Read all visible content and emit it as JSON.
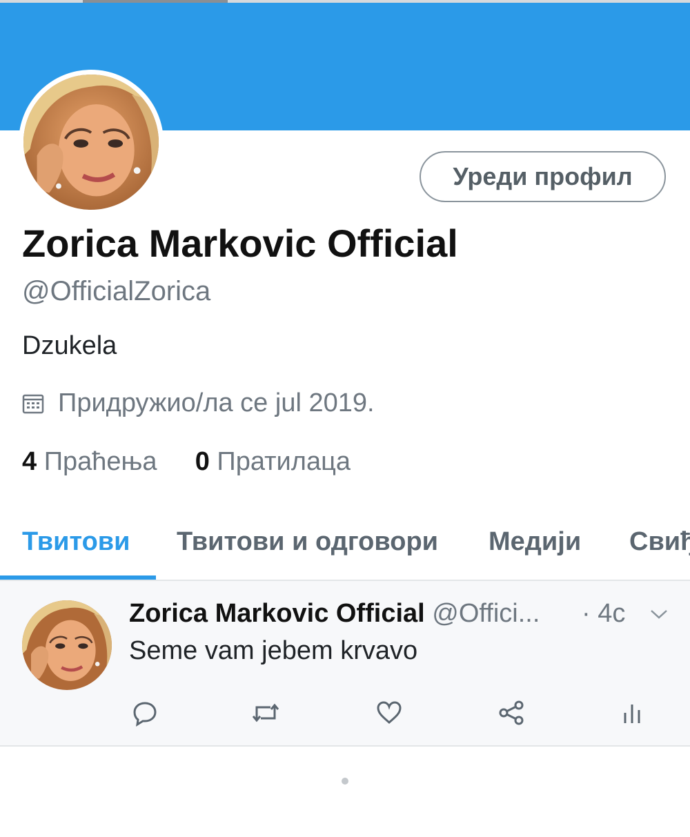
{
  "profile": {
    "edit_button": "Уреди профил",
    "display_name": "Zorica Markovic Official",
    "handle": "@OfficialZorica",
    "bio": "Dzukela",
    "joined": "Придружио/ла се jul 2019.",
    "following_count": "4",
    "following_label": "Праћења",
    "followers_count": "0",
    "followers_label": "Пратилаца"
  },
  "tabs": [
    {
      "label": "Твитови",
      "active": true
    },
    {
      "label": "Твитови и одговори"
    },
    {
      "label": "Медији"
    },
    {
      "label": "Свиђања"
    }
  ],
  "tweet": {
    "author": "Zorica Markovic Official",
    "handle_truncated": "@Offici...",
    "time": "· 4с",
    "text": "Seme vam jebem krvavo"
  },
  "icons": {
    "calendar": "calendar-icon",
    "reply": "reply-icon",
    "retweet": "retweet-icon",
    "like": "heart-icon",
    "share": "share-icon",
    "analytics": "analytics-icon",
    "menu": "chevron-down-icon"
  },
  "colors": {
    "accent": "#2b9ae8",
    "secondary_text": "#6e7780",
    "primary_text": "#111111"
  }
}
